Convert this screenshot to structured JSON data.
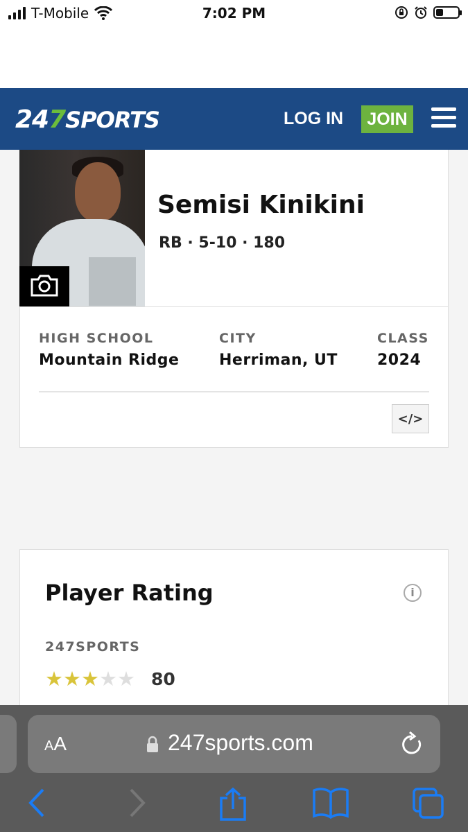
{
  "status_bar": {
    "carrier": "T-Mobile",
    "time": "7:02 PM"
  },
  "header": {
    "logo_num1": "24",
    "logo_num2": "7",
    "logo_word": "SPORTS",
    "login_label": "LOG IN",
    "join_label": "JOIN"
  },
  "player": {
    "name": "Semisi Kinikini",
    "meta": "RB · 5-10 · 180",
    "high_school_label": "HIGH SCHOOL",
    "high_school": "Mountain Ridge",
    "city_label": "CITY",
    "city": "Herriman, UT",
    "class_label": "CLASS",
    "class": "2024",
    "embed_label": "</>"
  },
  "rating": {
    "title": "Player Rating",
    "source": "247SPORTS",
    "stars_filled": 3,
    "stars_total": 5,
    "score": "80"
  },
  "browser": {
    "text_size_label_small": "A",
    "text_size_label_large": "A",
    "url": "247sports.com"
  },
  "colors": {
    "header_bg": "#1c4a85",
    "join_bg": "#6db33f",
    "logo_seven": "#6cbd3c",
    "star_on": "#d9c43a"
  }
}
